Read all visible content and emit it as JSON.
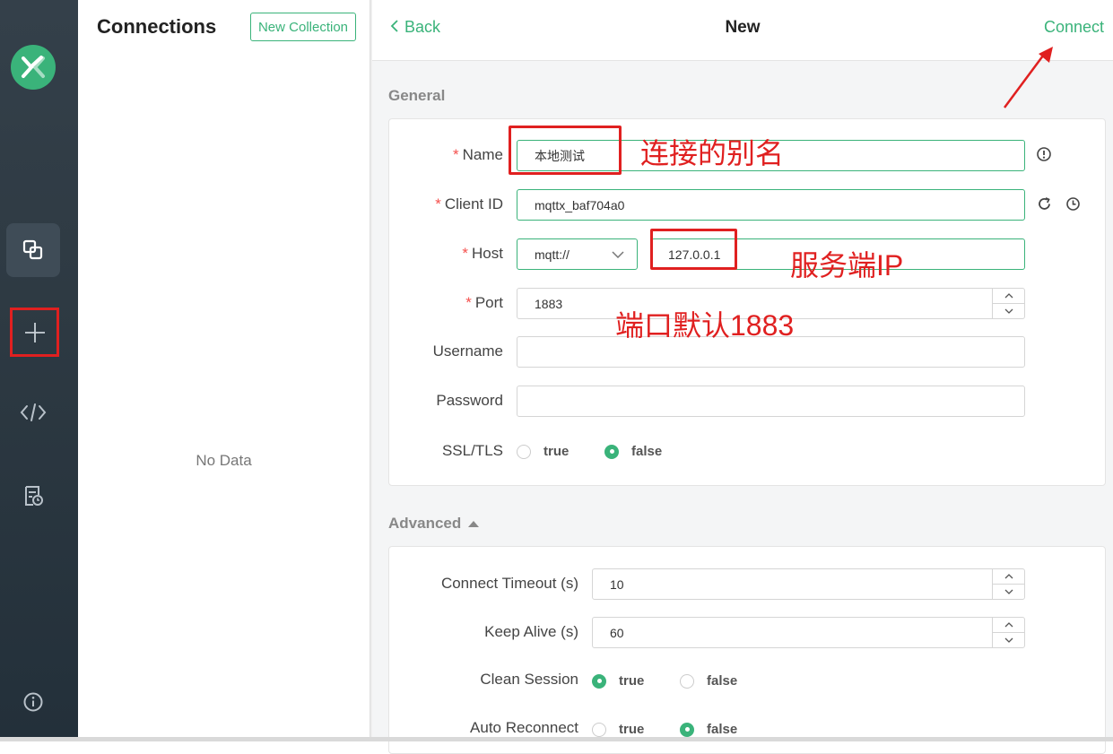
{
  "nav": {
    "items": [
      {
        "icon": "connections-icon"
      },
      {
        "icon": "plus-icon"
      },
      {
        "icon": "script-icon"
      },
      {
        "icon": "log-icon"
      },
      {
        "icon": "info-icon"
      }
    ]
  },
  "connections": {
    "title": "Connections",
    "new_collection_label": "New Collection",
    "empty_text": "No Data"
  },
  "header": {
    "back_label": "Back",
    "title": "New",
    "connect_label": "Connect"
  },
  "general": {
    "title": "General",
    "name": {
      "label": "Name",
      "value": "本地测试"
    },
    "client_id": {
      "label": "Client ID",
      "value": "mqttx_baf704a0"
    },
    "host": {
      "label": "Host",
      "protocol": "mqtt://",
      "value": "127.0.0.1"
    },
    "port": {
      "label": "Port",
      "value": "1883"
    },
    "username": {
      "label": "Username",
      "value": ""
    },
    "password": {
      "label": "Password",
      "value": ""
    },
    "ssl": {
      "label": "SSL/TLS",
      "true_label": "true",
      "false_label": "false",
      "selected": "false"
    }
  },
  "advanced": {
    "title": "Advanced",
    "connect_timeout": {
      "label": "Connect Timeout (s)",
      "value": "10"
    },
    "keep_alive": {
      "label": "Keep Alive (s)",
      "value": "60"
    },
    "clean_session": {
      "label": "Clean Session",
      "true_label": "true",
      "false_label": "false",
      "selected": "true"
    },
    "auto_reconnect": {
      "label": "Auto Reconnect",
      "true_label": "true",
      "false_label": "false",
      "selected": "false"
    }
  },
  "annotations": {
    "name_note": "连接的别名",
    "host_note": "服务端IP",
    "port_note": "端口默认1883"
  },
  "colors": {
    "accent": "#3ab37a",
    "annotation": "#e02020",
    "nav_bg": "#2e3a43"
  }
}
